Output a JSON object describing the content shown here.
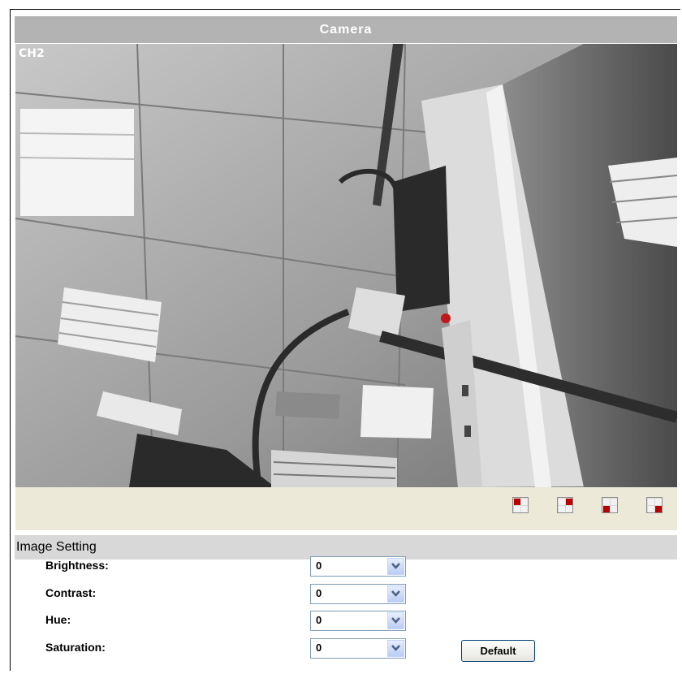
{
  "header": {
    "title": "Camera"
  },
  "video": {
    "channel_label": "CH2"
  },
  "layout_buttons": [
    {
      "name": "layout-1-icon",
      "active": [
        0
      ]
    },
    {
      "name": "layout-2-icon",
      "active": [
        1
      ]
    },
    {
      "name": "layout-3-icon",
      "active": [
        2
      ]
    },
    {
      "name": "layout-4-icon",
      "active": [
        3
      ]
    }
  ],
  "image_setting": {
    "title": "Image Setting",
    "rows": [
      {
        "label": "Brightness:",
        "value": "0"
      },
      {
        "label": "Contrast:",
        "value": "0"
      },
      {
        "label": "Hue:",
        "value": "0"
      },
      {
        "label": "Saturation:",
        "value": "0"
      }
    ],
    "default_label": "Default"
  },
  "colors": {
    "title_bar": "#b3b3b3",
    "strip": "#ece9d8",
    "active_quad": "#b80000"
  }
}
